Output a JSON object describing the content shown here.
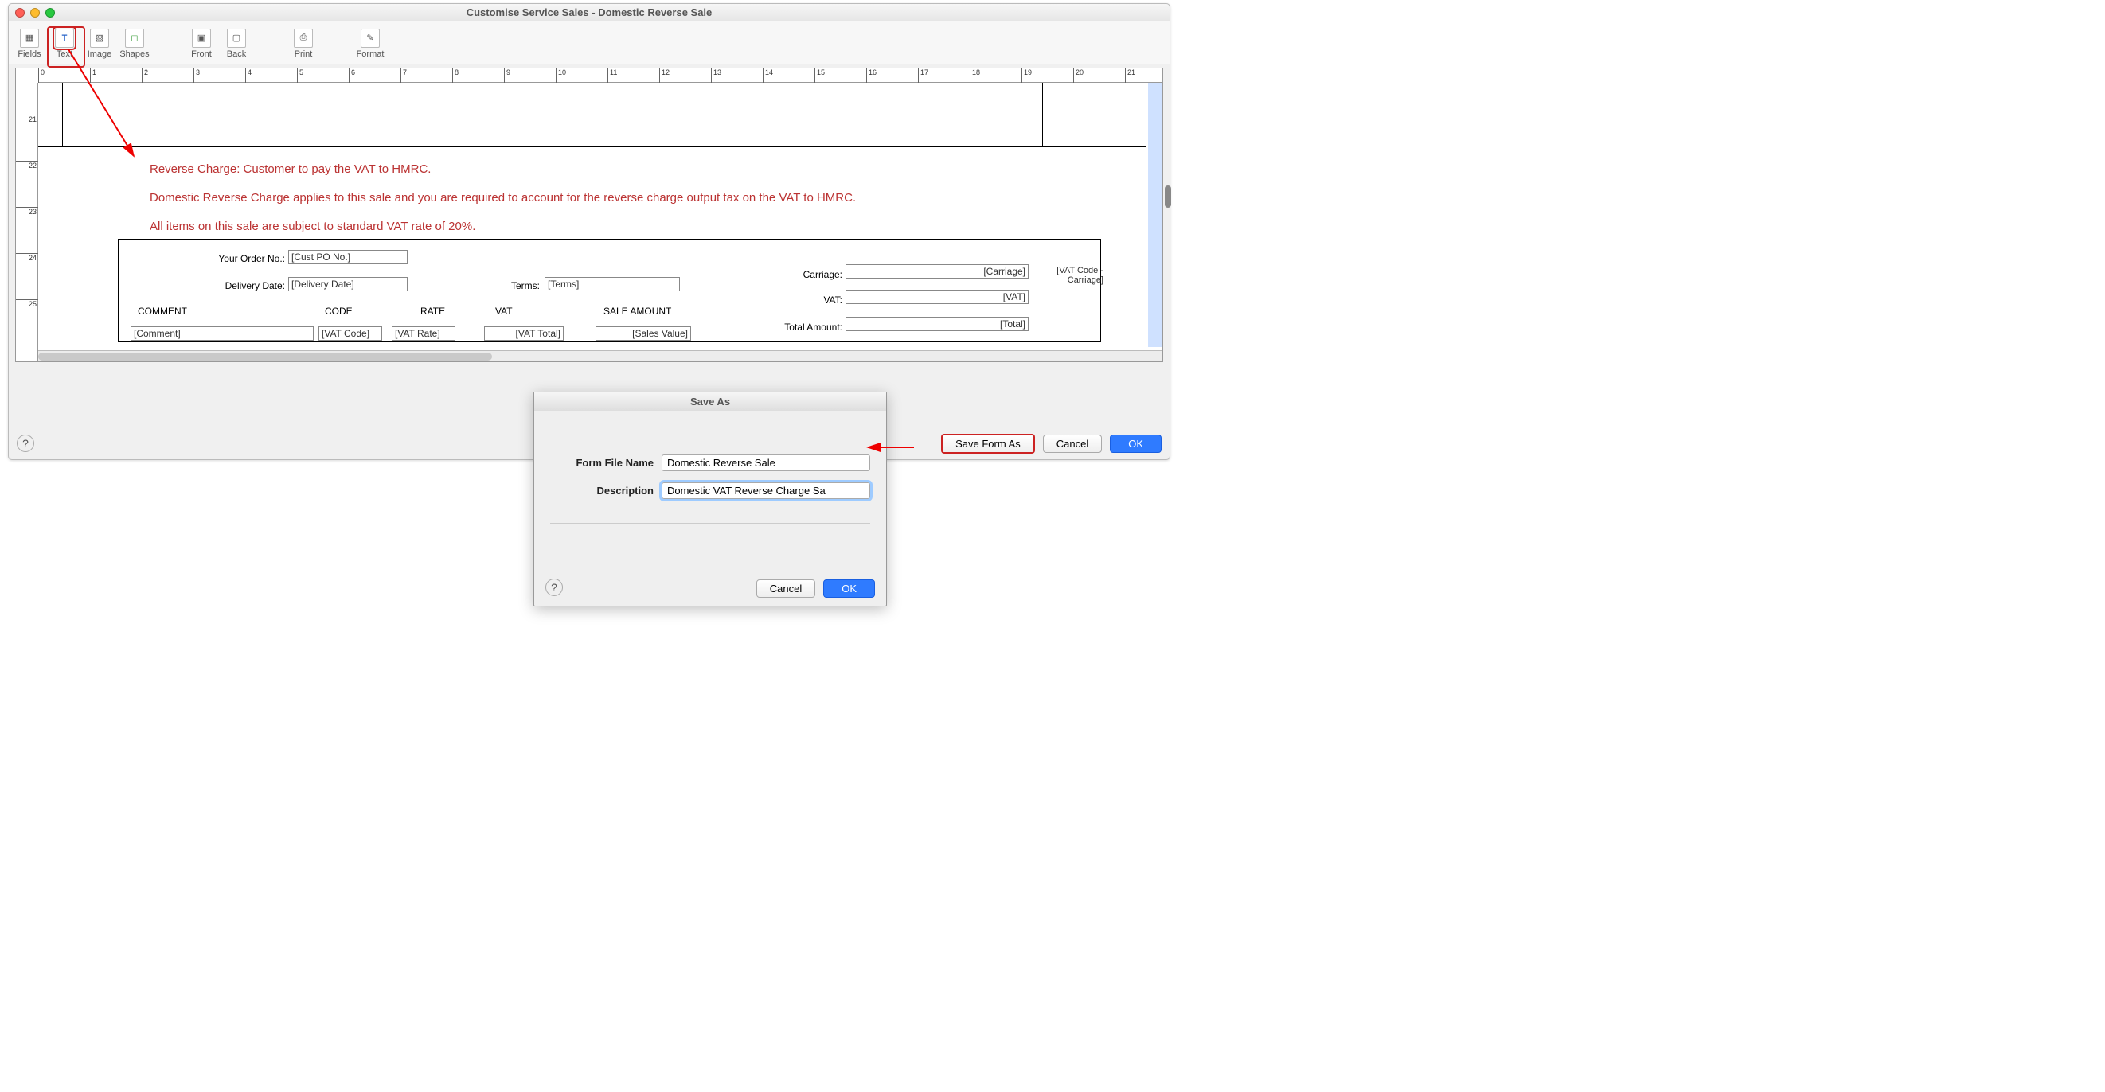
{
  "window": {
    "title": "Customise Service Sales - Domestic Reverse Sale"
  },
  "toolbar": {
    "fields": "Fields",
    "text": "Text",
    "image": "Image",
    "shapes": "Shapes",
    "front": "Front",
    "back": "Back",
    "print": "Print",
    "format": "Format"
  },
  "hruler": [
    "0",
    "1",
    "2",
    "3",
    "4",
    "5",
    "6",
    "7",
    "8",
    "9",
    "10",
    "11",
    "12",
    "13",
    "14",
    "15",
    "16",
    "17",
    "18",
    "19",
    "20",
    "21"
  ],
  "vruler": [
    "21",
    "22",
    "23",
    "24",
    "25"
  ],
  "notes": {
    "l1": "Reverse Charge: Customer to pay the VAT to HMRC.",
    "l2": "Domestic Reverse Charge applies to this sale and you are required to account for the reverse charge output tax on the VAT to HMRC.",
    "l3": "All items on this sale are subject to standard VAT rate of 20%."
  },
  "form_labels": {
    "order_no": "Your Order No.:",
    "delivery": "Delivery Date:",
    "terms": "Terms:",
    "carriage": "Carriage:",
    "vat": "VAT:",
    "total": "Total Amount:"
  },
  "placeholders": {
    "cust_po": "[Cust PO No.]",
    "del_date": "[Delivery Date]",
    "terms": "[Terms]",
    "carriage": "[Carriage]",
    "vat_code_carriage": "[VAT Code - Carriage]",
    "vat": "[VAT]",
    "total": "[Total]"
  },
  "cols": {
    "comment": "COMMENT",
    "code": "CODE",
    "rate": "RATE",
    "vat": "VAT",
    "amount": "SALE AMOUNT",
    "ph_comment": "[Comment]",
    "ph_code": "[VAT Code]",
    "ph_rate": "[VAT Rate]",
    "ph_vat": "[VAT Total]",
    "ph_amount": "[Sales Value]"
  },
  "footer": {
    "save_as": "Save Form As",
    "cancel": "Cancel",
    "ok": "OK"
  },
  "dialog": {
    "title": "Save As",
    "name_label": "Form File Name",
    "name_value": "Domestic Reverse Sale",
    "desc_label": "Description",
    "desc_value": "Domestic VAT Reverse Charge Sa",
    "cancel": "Cancel",
    "ok": "OK"
  },
  "help_glyph": "?"
}
